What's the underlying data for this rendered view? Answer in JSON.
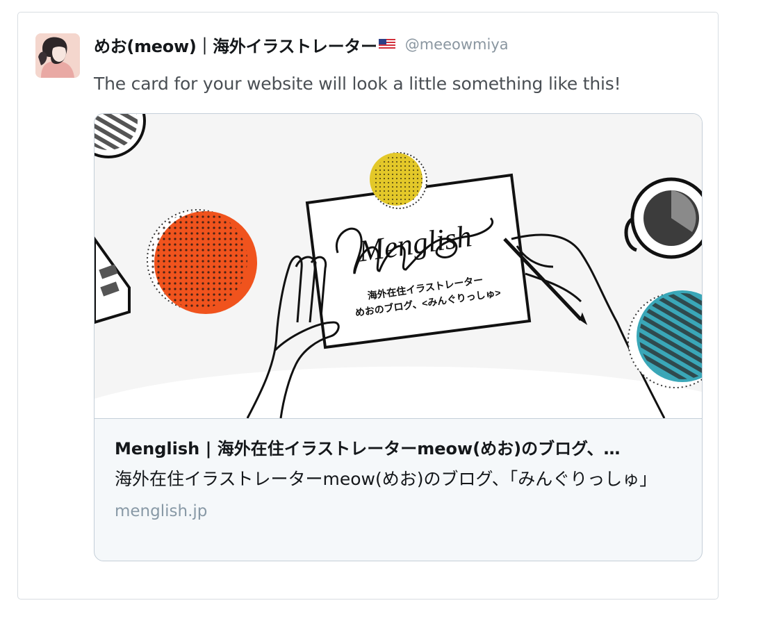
{
  "tweet": {
    "display_name": "めお(meow)｜海外イラストレーター",
    "handle": "@meeowmiya",
    "text": "The card for your website will look a little something like this!",
    "flag_icon": "us-flag-icon"
  },
  "card": {
    "image_lettering": "Menglish",
    "image_line1": "海外在住イラストレーター",
    "image_line2": "めおのブログ、<みんぐりっしゅ>",
    "title": "Menglish | 海外在住イラストレーターmeow(めお)のブログ、…",
    "description": "海外在住イラストレーターmeow(めお)のブログ、「みんぐりっしゅ」",
    "domain": "menglish.jp"
  },
  "colors": {
    "border": "#d8dde2",
    "card_border": "#c4ced8",
    "card_bg": "#f5f8fa",
    "handle": "#8a96a0",
    "domain": "#8899a6",
    "orange_dot": "#f0531d",
    "yellow_dot": "#e3c829",
    "teal_dot": "#3aa7b8"
  }
}
